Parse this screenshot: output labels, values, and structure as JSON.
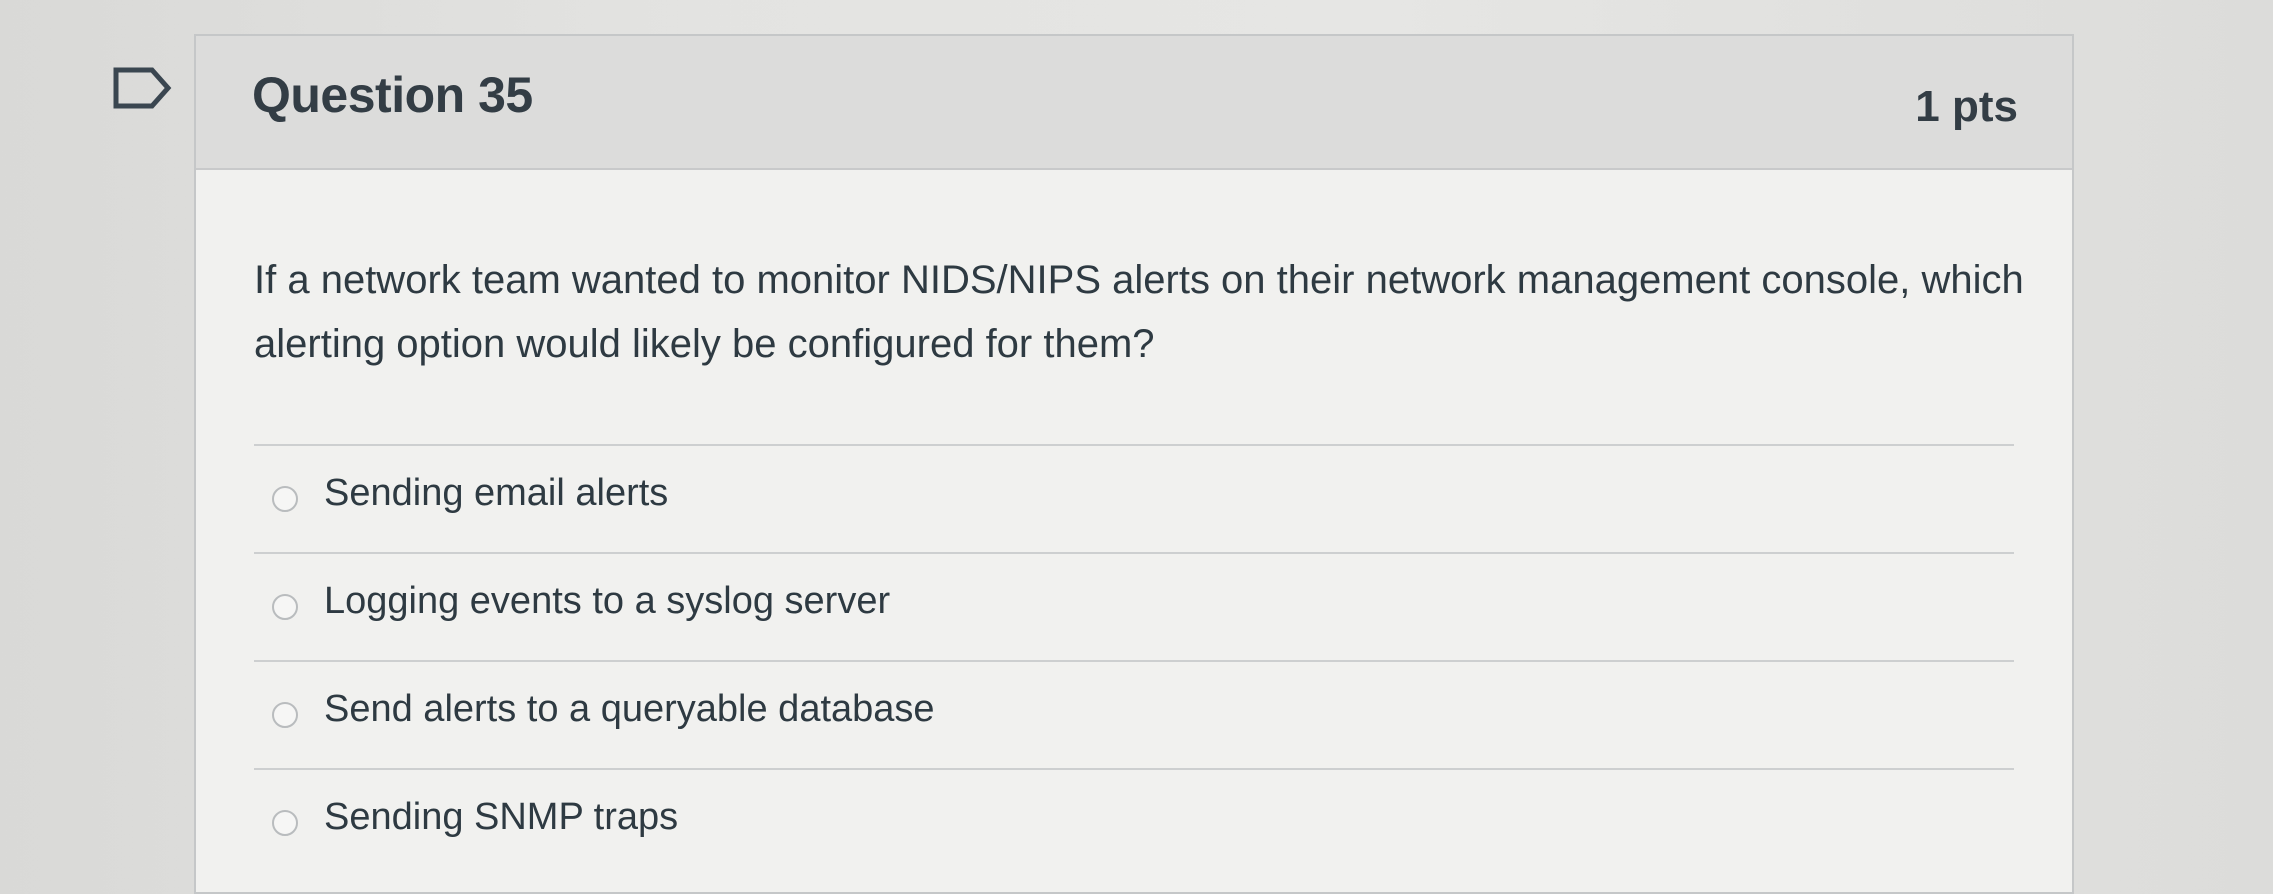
{
  "question": {
    "title": "Question 35",
    "points": "1 pts",
    "text": "If a network team wanted to monitor NIDS/NIPS alerts on their network management console, which alerting option would likely be configured for them?",
    "flag_icon": "flag-outline-icon"
  },
  "answers": [
    {
      "label": "Sending email alerts",
      "selected": false
    },
    {
      "label": "Logging events to a syslog server",
      "selected": false
    },
    {
      "label": "Send alerts to a queryable database",
      "selected": false
    },
    {
      "label": "Sending SNMP traps",
      "selected": false
    }
  ],
  "colors": {
    "header_bg": "#dcdcdb",
    "card_bg": "#f1f1ef",
    "text": "#2e3a42",
    "border": "#c5c7c8"
  }
}
